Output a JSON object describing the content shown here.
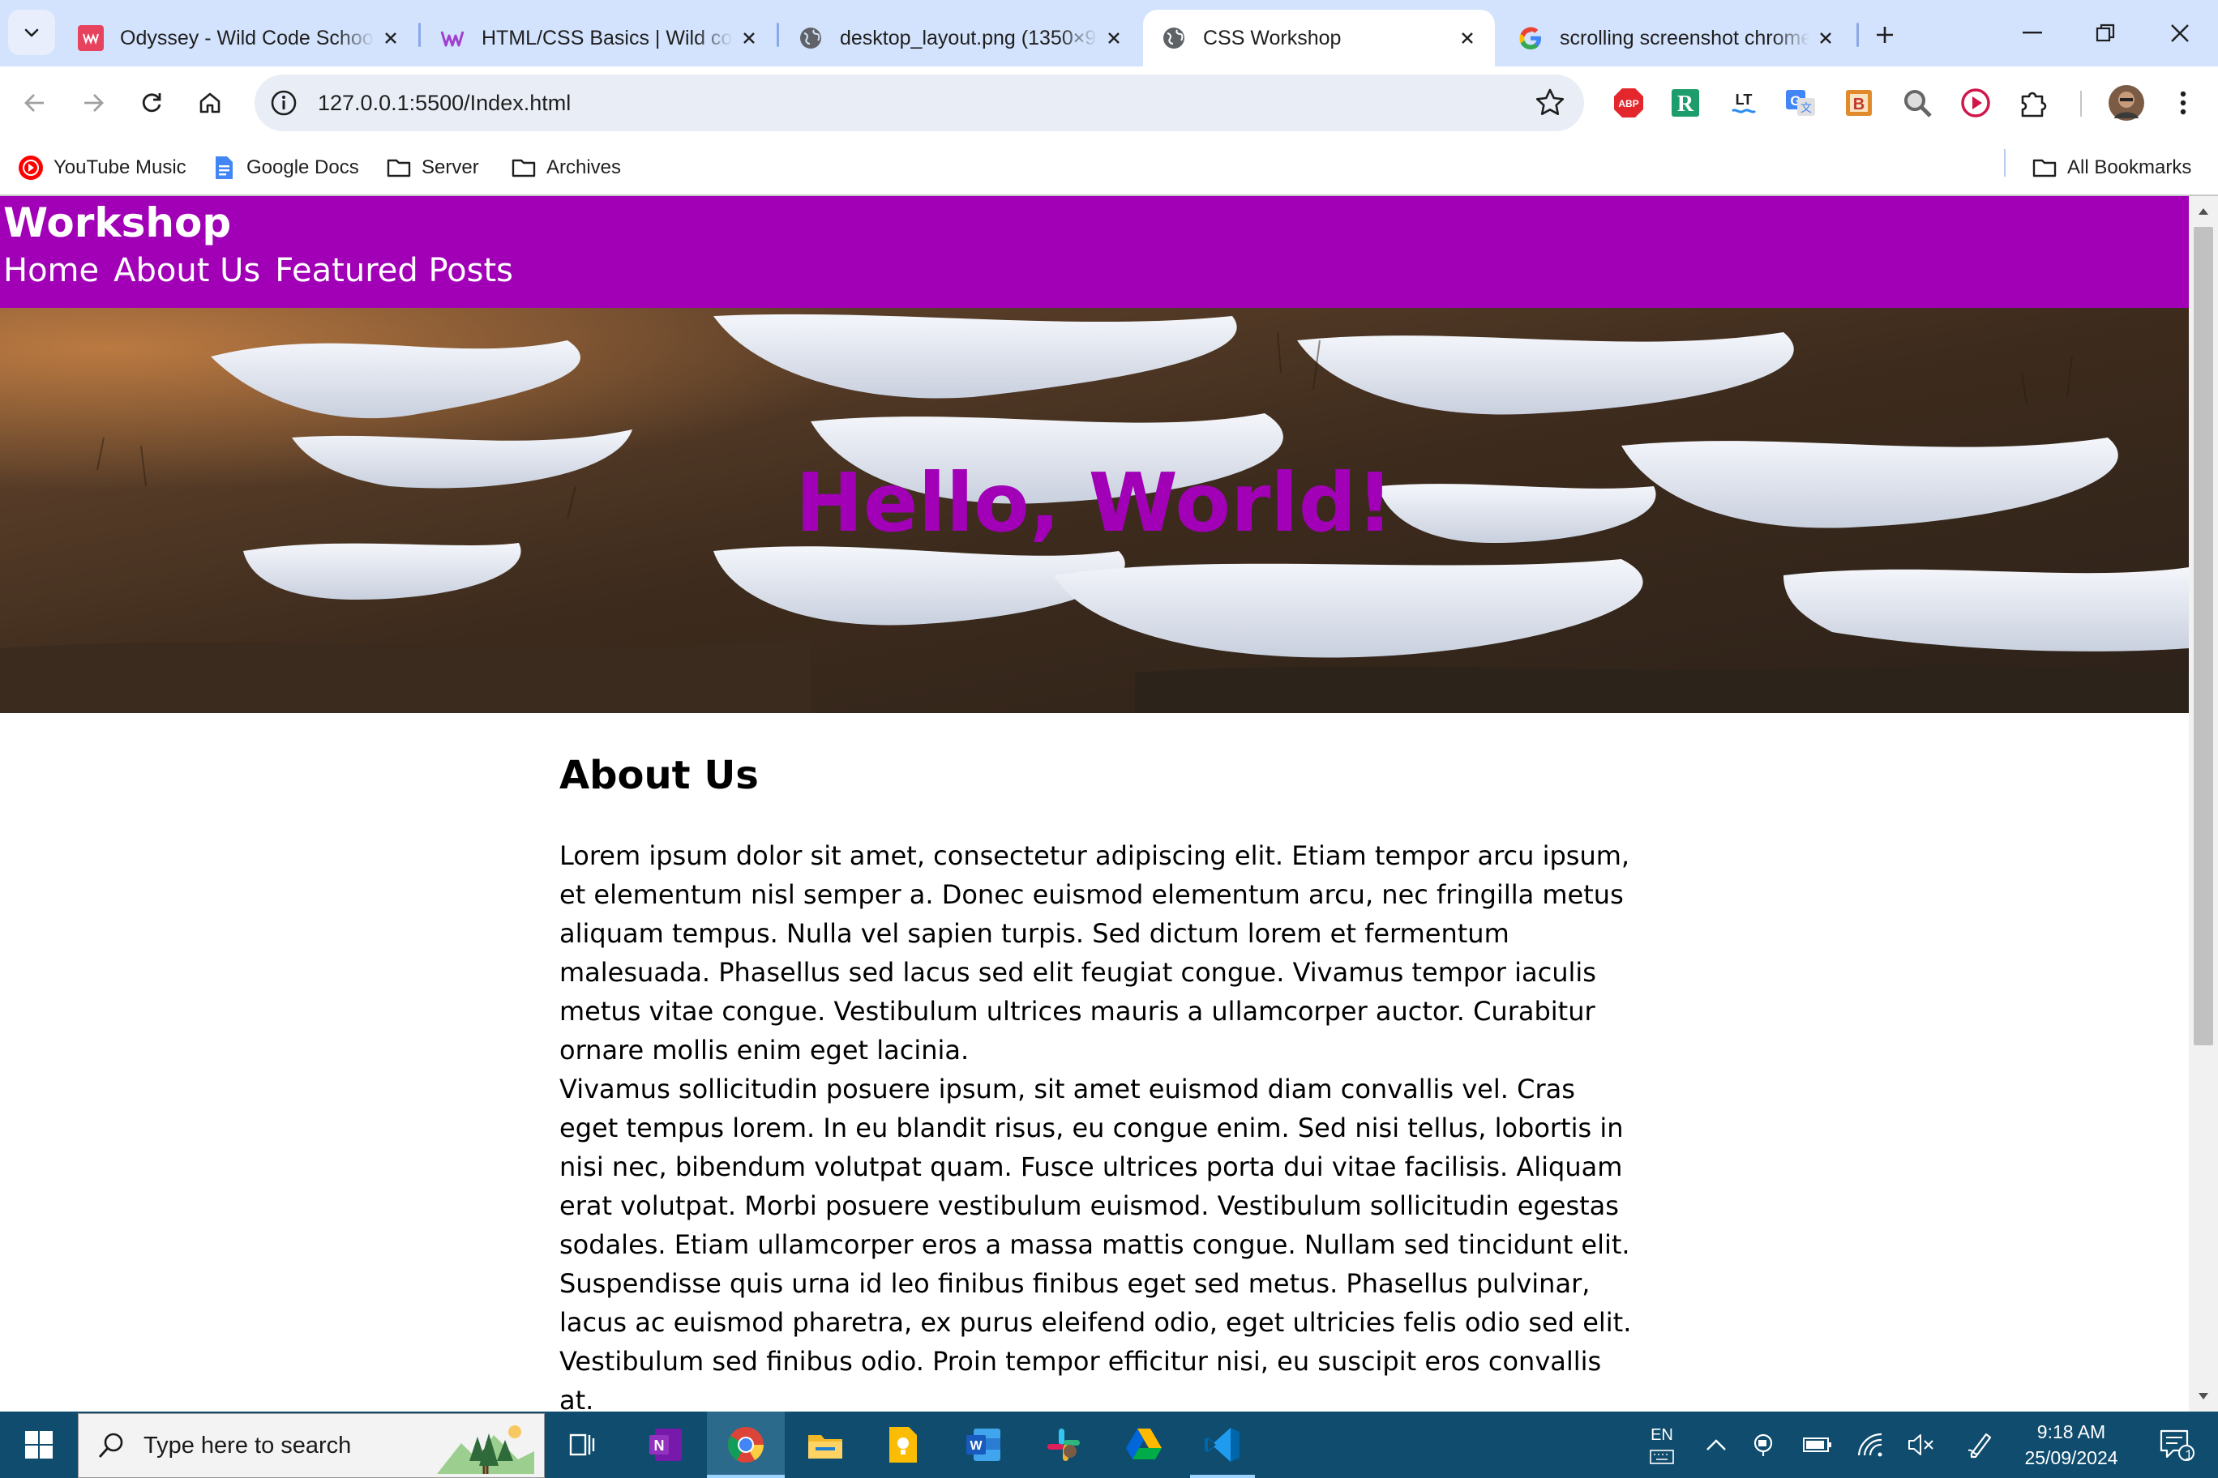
{
  "browser": {
    "tabs": [
      {
        "title": "Odyssey - Wild Code School",
        "icon": "wild-code-school-icon",
        "active": false
      },
      {
        "title": "HTML/CSS Basics | Wild code",
        "icon": "wild-code-school-icon",
        "active": false
      },
      {
        "title": "desktop_layout.png (1350×9",
        "icon": "globe-icon",
        "active": false
      },
      {
        "title": "CSS Workshop",
        "icon": "globe-icon",
        "active": true
      },
      {
        "title": "scrolling screenshot chrome",
        "icon": "google-icon",
        "active": false
      }
    ],
    "url": "127.0.0.1:5500/Index.html",
    "bookmarks": [
      {
        "label": "YouTube Music",
        "icon": "youtube-music-icon"
      },
      {
        "label": "Google Docs",
        "icon": "google-docs-icon"
      },
      {
        "label": "Server",
        "icon": "folder-icon"
      },
      {
        "label": "Archives",
        "icon": "folder-icon"
      }
    ],
    "all_bookmarks": "All Bookmarks",
    "extensions": [
      "adblock-icon",
      "r-extension-icon",
      "languagetool-icon",
      "google-translate-icon",
      "b-extension-icon",
      "zoom-icon",
      "record-icon",
      "puzzle-extensions-icon"
    ]
  },
  "page": {
    "site_title": "Workshop",
    "nav": [
      "Home",
      "About Us",
      "Featured Posts"
    ],
    "hero_title": "Hello, World!",
    "section_heading": "About Us",
    "paragraph_1": "Lorem ipsum dolor sit amet, consectetur adipiscing elit. Etiam tempor arcu ipsum, et elementum nisl semper a. Donec euismod elementum arcu, nec fringilla metus aliquam tempus. Nulla vel sapien turpis. Sed dictum lorem et fermentum malesuada. Phasellus sed lacus sed elit feugiat congue. Vivamus tempor iaculis metus vitae congue. Vestibulum ultrices mauris a ullamcorper auctor. Curabitur ornare mollis enim eget lacinia.",
    "paragraph_2": "Vivamus sollicitudin posuere ipsum, sit amet euismod diam convallis vel. Cras eget tempus lorem. In eu blandit risus, eu congue enim. Sed nisi tellus, lobortis in nisi nec, bibendum volutpat quam. Fusce ultrices porta dui vitae facilisis. Aliquam erat volutpat. Morbi posuere vestibulum euismod. Vestibulum sollicitudin egestas sodales. Etiam ullamcorper eros a massa mattis congue. Nullam sed tincidunt elit. Suspendisse quis urna id leo finibus finibus eget sed metus. Phasellus pulvinar, lacus ac euismod pharetra, ex purus eleifend odio, eget ultricies felis odio sed elit. Vestibulum sed finibus odio. Proin tempor efficitur nisi, eu suscipit eros convallis at.",
    "accent_color": "#a100b7"
  },
  "taskbar": {
    "search_placeholder": "Type here to search",
    "apps": [
      "task-view-icon",
      "onenote-icon",
      "chrome-icon",
      "file-explorer-icon",
      "google-keep-icon",
      "word-icon",
      "slack-icon",
      "google-drive-icon",
      "vscode-icon"
    ],
    "language": "EN",
    "time": "9:18 AM",
    "date": "25/09/2024",
    "notification_count": "1"
  }
}
